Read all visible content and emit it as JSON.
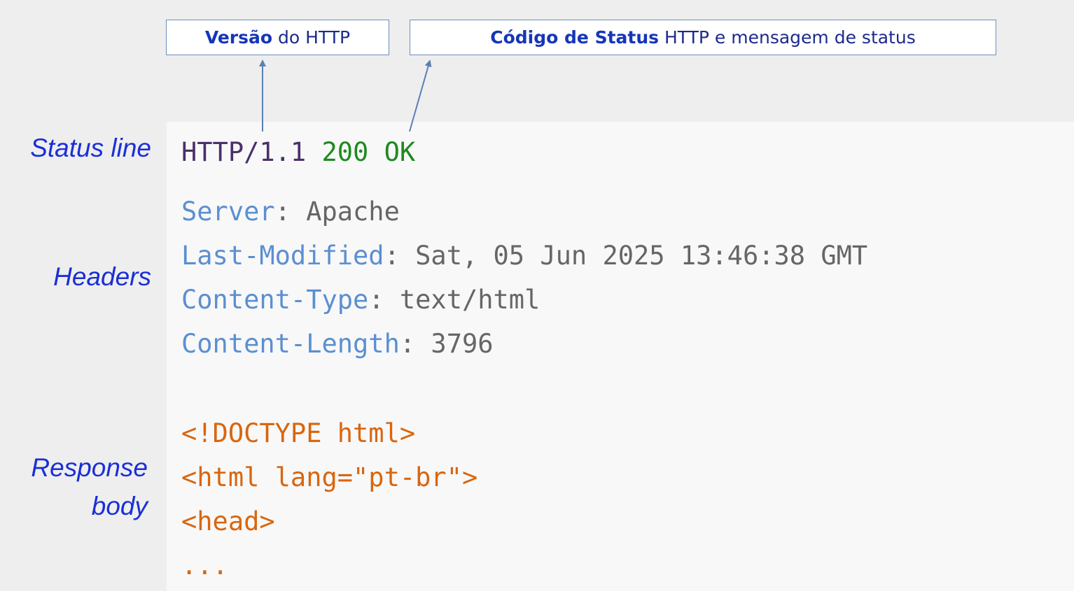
{
  "callouts": {
    "version": {
      "bold": "Versão",
      "rest": " do HTTP"
    },
    "status": {
      "bold": "Código de Status",
      "rest": " HTTP e mensagem de status"
    }
  },
  "labels": {
    "status_line": "Status line",
    "headers": "Headers",
    "response_body_line1": "Response",
    "response_body_line2": "body"
  },
  "status_line": {
    "version": "HTTP/1.1",
    "code_and_message": "200 OK"
  },
  "headers": [
    {
      "name": "Server",
      "value": ": Apache"
    },
    {
      "name": "Last-Modified",
      "value": ": Sat, 05 Jun 2025 13:46:38 GMT"
    },
    {
      "name": "Content-Type",
      "value": ": text/html"
    },
    {
      "name": "Content-Length",
      "value": ": 3796"
    }
  ],
  "body_lines": [
    "<!DOCTYPE html>",
    "<html lang=\"pt-br\">",
    "<head>",
    "..."
  ],
  "colors": {
    "label_blue": "#1a2fd6",
    "version": "#4b2f6b",
    "status": "#1f8a1f",
    "header_name": "#5b8fd1",
    "header_value": "#666666",
    "body": "#d9660e",
    "arrow": "#5b7fb5"
  }
}
